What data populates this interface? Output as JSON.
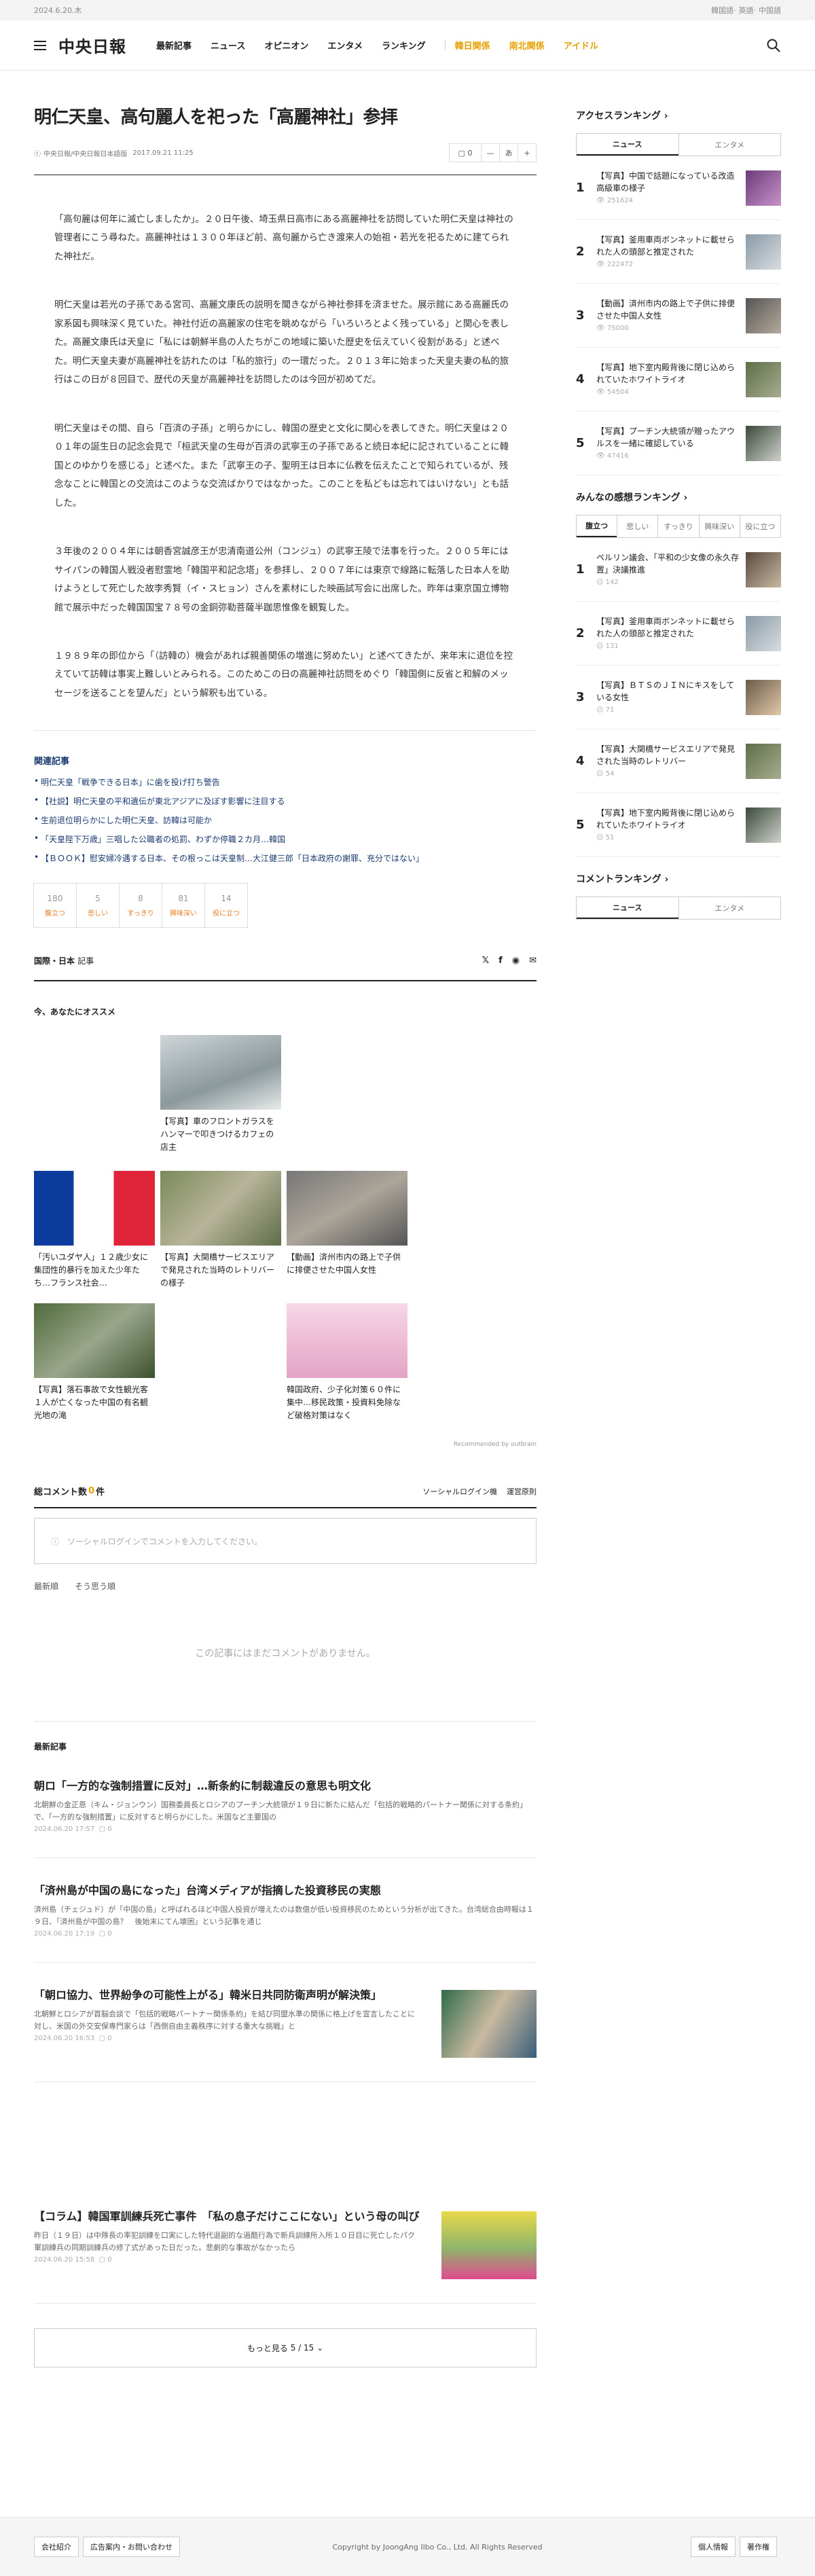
{
  "topbar": {
    "date": "2024.6.20.木",
    "langs": [
      "韓国語",
      "英語",
      "中国語"
    ]
  },
  "header": {
    "logo": "中央日報",
    "nav": [
      "最新記事",
      "ニュース",
      "オピニオン",
      "エンタメ",
      "ランキング"
    ],
    "nav_highlight": [
      "韓日関係",
      "南北関係",
      "アイドル"
    ]
  },
  "article": {
    "title": "明仁天皇、高句麗人を祀った「高麗神社」参拝",
    "source": "中央日報/中央日報日本語版",
    "date": "2017.09.21 11:25",
    "comment_count": "0",
    "font_btn": "あ",
    "paragraphs": [
      "「高句麗は何年に滅亡しましたか」。２０日午後、埼玉県日高市にある高麗神社を訪問していた明仁天皇は神社の管理者にこう尋ねた。高麗神社は１３００年ほど前、高句麗から亡き渡来人の始祖・若光を祀るために建てられた神社だ。",
      "明仁天皇は若光の子孫である宮司、高麗文康氏の説明を聞きながら神社参拝を済ませた。展示館にある高麗氏の家系図も興味深く見ていた。神社付近の高麗家の住宅を眺めながら「いろいろとよく残っている」と関心を表した。高麗文康氏は天皇に「私には朝鮮半島の人たちがこの地域に築いた歴史を伝えていく役割がある」と述べた。明仁天皇夫妻が高麗神社を訪れたのは「私的旅行」の一環だった。２０１３年に始まった天皇夫妻の私的旅行はこの日が８回目で、歴代の天皇が高麗神社を訪問したのは今回が初めてだ。",
      "明仁天皇はその間、自ら「百済の子孫」と明らかにし、韓国の歴史と文化に関心を表してきた。明仁天皇は２００１年の誕生日の記念会見で「桓武天皇の生母が百済の武寧王の子孫であると続日本紀に記されていることに韓国とのゆかりを感じる」と述べた。また「武寧王の子、聖明王は日本に仏教を伝えたことで知られているが、残念なことに韓国との交流はこのような交流ばかりではなかった。このことを私どもは忘れてはいけない」とも話した。",
      "３年後の２００４年には朝香宮誠彦王が忠清南道公州（コンジュ）の武寧王陵で法事を行った。２００５年にはサイパンの韓国人戦没者慰霊地「韓国平和記念塔」を参拝し、２００７年には東京で線路に転落した日本人を助けようとして死亡した故李秀賢（イ・スヒョン）さんを素材にした映画試写会に出席した。昨年は東京国立博物館で展示中だった韓国国宝７８号の金銅弥勒菩薩半跏思惟像を観覧した。",
      "１９８９年の即位から「（訪韓の）機会があれば親善関係の増進に努めたい」と述べてきたが、来年末に退位を控えていて訪韓は事実上難しいとみられる。このためこの日の高麗神社訪問をめぐり「韓国側に反省と和解のメッセージを送ることを望んだ」という解釈も出ている。"
    ]
  },
  "related": {
    "heading": "関連記事",
    "items": [
      "明仁天皇「戦争できる日本」に歯を投げ打ち警告",
      "【社説】明仁天皇の平和遺伝が東北アジアに及ぼす影響に注目する",
      "生前退位明らかにした明仁天皇、訪韓は可能か",
      "「天皇陛下万歳」三唱した公職者の処罰、わずか停職２カ月…韓国",
      "【ＢＯＯＫ】慰安婦冷遇する日本、その根っこは天皇制…大江健三郎「日本政府の謝罪、充分ではない」"
    ]
  },
  "reactions": [
    {
      "count": "180",
      "label": "腹立つ"
    },
    {
      "count": "5",
      "label": "悲しい"
    },
    {
      "count": "8",
      "label": "すっきり"
    },
    {
      "count": "81",
      "label": "興味深い"
    },
    {
      "count": "14",
      "label": "役に立つ"
    }
  ],
  "share": {
    "section": "国際・日本",
    "suffix": "記事"
  },
  "recommend": {
    "heading": "今、あなたにオススメ",
    "cards": [
      "【写真】車のフロントガラスをハンマーで叩きつけるカフェの店主",
      "「汚いユダヤ人」１２歳少女に集団性的暴行を加えた少年たち…フランス社会…",
      "【写真】大関橋サービスエリアで発見された当時のレトリバーの様子",
      "【動画】済州市内の路上で子供に排便させた中国人女性",
      "【写真】落石事故で女性観光客１人が亡くなった中国の有名観光地の滝",
      "韓国政府、少子化対策６０件に集中…移民政策・投資料免除など破格対策はなく"
    ],
    "brand": "Recommended by outbrain"
  },
  "comments": {
    "label_pre": "総コメント数",
    "count": "0",
    "label_post": "件",
    "social_login": "ソーシャルログイン機",
    "rules": "運営原則",
    "placeholder": "ソーシャルログインでコメントを入力してください。",
    "tabs": [
      "最新順",
      "そう思う順"
    ],
    "empty": "この記事にはまだコメントがありません。"
  },
  "latest": {
    "heading": "最新記事",
    "items": [
      {
        "title": "朝ロ「一方的な強制措置に反対」…新条約に制裁違反の意思も明文化",
        "desc": "北朝鮮の金正恩（キム・ジョンウン）国務委員長とロシアのプーチン大統領が１９日に新たに結んだ「包括的戦略的パートナー関係に対する条約」で、「一方的な強制措置」に反対すると明らかにした。米国など主要国の",
        "date": "2024.06.20 17:57",
        "comments": "0"
      },
      {
        "title": "「済州島が中国の島になった」台湾メディアが指摘した投資移民の実態",
        "desc": "済州島（チェジュド）が「中国の島」と呼ばれるほど中国人投資が増えたのは数億が低い投資移民のためという分析が出てきた。台湾総合由時報は１９日、「済州島が中国の島？　後始末にてん壊困」という記事を通じ",
        "date": "2024.06.20 17:19",
        "comments": "0"
      },
      {
        "title": "「朝ロ協力、世界紛争の可能性上がる」韓米日共同防衛声明が解決策」",
        "desc": "北朝鮮とロシアが首脳会談で「包括的戦略パートナー関係条約」を結び同盟水準の関係に格上げを宣言したことに対し、米国の外交安保専門家らは「西側自由主義秩序に対する重大な挑戦」と",
        "date": "2024.06.20 16:53",
        "comments": "0"
      },
      {
        "title": "【コラム】韓国軍訓練兵死亡事件　「私の息子だけここにない」という母の叫び",
        "desc": "昨日（１９日）は中隊長の率犯訓練を口実にした特代退副的な過酷行為で新兵訓練所入所１０日目に死亡したパク軍訓練兵の同期訓練兵の修了式があった日だった。悲劇的な事故がなかったら",
        "date": "2024.06.20 15:58",
        "comments": "0"
      }
    ],
    "more_label": "もっと見る",
    "more_page": "5 / 15"
  },
  "aside": {
    "access_heading": "アクセスランキング",
    "access_tabs": [
      "ニュース",
      "エンタメ"
    ],
    "access": [
      {
        "title": "【写真】中国で話題になっている改造高級車の様子",
        "views": "251624"
      },
      {
        "title": "【写真】釜用車両ボンネットに載せられた人の頭部と推定された",
        "views": "222472"
      },
      {
        "title": "【動画】済州市内の路上で子供に排便させた中国人女性",
        "views": "75000"
      },
      {
        "title": "【写真】地下室内殿背後に閉じ込められていたホワイトライオ",
        "views": "54504"
      },
      {
        "title": "【写真】プーチン大統領が贈ったアウルスを一緒に確認している",
        "views": "47416"
      }
    ],
    "emotion_heading": "みんなの感想ランキング",
    "emotion_tabs": [
      "腹立つ",
      "悲しい",
      "すっきり",
      "興味深い",
      "役に立つ"
    ],
    "emotion": [
      {
        "title": "ペルリン議会、「平和の少女像の永久存置」決議推進",
        "views": "142"
      },
      {
        "title": "【写真】釜用車両ボンネットに載せられた人の頭部と推定された",
        "views": "131"
      },
      {
        "title": "【写真】ＢＴＳのＪＩＮにキスをしている女性",
        "views": "71"
      },
      {
        "title": "【写真】大関橋サービスエリアで発見された当時のレトリバー",
        "views": "54"
      },
      {
        "title": "【写真】地下室内殿背後に閉じ込められていたホワイトライオ",
        "views": "51"
      }
    ],
    "comment_heading": "コメントランキング",
    "comment_tabs": [
      "ニュース",
      "エンタメ"
    ]
  },
  "footer": {
    "left": [
      "会社紹介",
      "広告案内・お問い合わせ"
    ],
    "copyright": "Copyright by JoongAng Ilbo Co., Ltd. All Rights Reserved",
    "right": [
      "個人情報",
      "著作権"
    ]
  }
}
